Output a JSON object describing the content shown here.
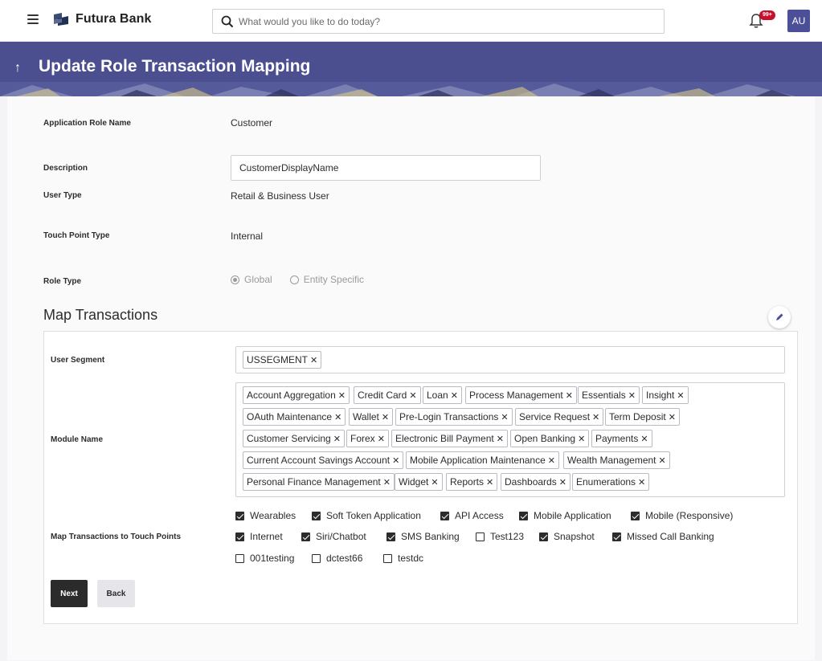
{
  "topbar": {
    "brand": "Futura Bank",
    "search_placeholder": "What would you like to do today?",
    "notification_count": "99+",
    "avatar_initials": "AU"
  },
  "header": {
    "title": "Update Role Transaction Mapping"
  },
  "form": {
    "application_role_name": {
      "label": "Application Role Name",
      "value": "Customer"
    },
    "description": {
      "label": "Description",
      "value": "CustomerDisplayName"
    },
    "user_type": {
      "label": "User Type",
      "value": "Retail & Business User"
    },
    "touch_point_type": {
      "label": "Touch Point Type",
      "value": "Internal"
    },
    "role_type": {
      "label": "Role Type",
      "options": [
        {
          "label": "Global",
          "selected": true
        },
        {
          "label": "Entity Specific",
          "selected": false
        }
      ]
    }
  },
  "map_transactions": {
    "title": "Map Transactions",
    "user_segment": {
      "label": "User Segment",
      "tags": [
        "USSEGMENT"
      ]
    },
    "module_name": {
      "label": "Module Name",
      "rows": [
        [
          "Account Aggregation",
          "Credit Card",
          "Loan",
          "Process Management",
          "Essentials",
          "Insight"
        ],
        [
          "OAuth Maintenance",
          "Wallet",
          "Pre-Login Transactions",
          "Service Request",
          "Term Deposit"
        ],
        [
          "Customer Servicing",
          "Forex",
          "Electronic Bill Payment",
          "Open Banking",
          "Payments"
        ],
        [
          "Current Account Savings Account",
          "Mobile Application Maintenance",
          "Wealth Management"
        ],
        [
          "Personal Finance Management",
          "Widget",
          "Reports",
          "Dashboards",
          "Enumerations"
        ]
      ]
    },
    "touch_points": {
      "label": "Map Transactions to Touch Points",
      "rows": [
        [
          {
            "label": "Wearables",
            "checked": true
          },
          {
            "label": "Soft Token Application",
            "checked": true
          },
          {
            "label": "API Access",
            "checked": true
          },
          {
            "label": "Mobile Application",
            "checked": true
          },
          {
            "label": "Mobile (Responsive)",
            "checked": true
          }
        ],
        [
          {
            "label": "Internet",
            "checked": true
          },
          {
            "label": "Siri/Chatbot",
            "checked": true
          },
          {
            "label": "SMS Banking",
            "checked": true
          },
          {
            "label": "Test123",
            "checked": false
          },
          {
            "label": "Snapshot",
            "checked": true
          },
          {
            "label": "Missed Call Banking",
            "checked": true
          }
        ],
        [
          {
            "label": "001testing",
            "checked": false
          },
          {
            "label": "dctest66",
            "checked": false
          },
          {
            "label": "testdc",
            "checked": false
          }
        ]
      ]
    }
  },
  "buttons": {
    "next": "Next",
    "back": "Back"
  },
  "icons": {
    "menu": "hamburger-menu-icon",
    "logo": "bank-logo-icon",
    "search": "search-icon",
    "notifications": "bell-icon",
    "back": "up-arrow-icon",
    "edit": "pencil-icon",
    "remove_tag": "close-icon"
  }
}
